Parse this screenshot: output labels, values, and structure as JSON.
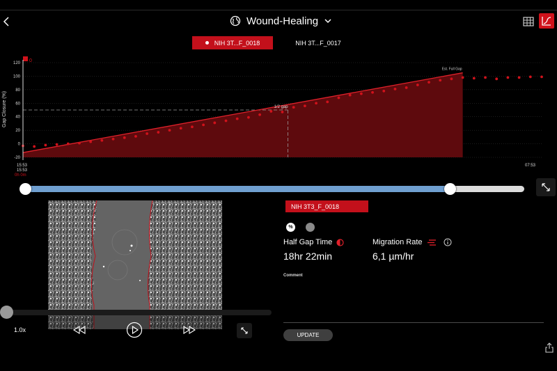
{
  "header": {
    "title": "Wound-Healing",
    "back_icon": "chevron-left-icon",
    "globe_icon": "globe-icon",
    "dropdown_icon": "chevron-down-icon",
    "grid_icon": "table-grid-icon",
    "graph_icon": "line-graph-icon",
    "accent_color": "#c3101b"
  },
  "tabs": [
    {
      "label": "NIH 3T...F_0018",
      "active": true
    },
    {
      "label": "NIH 3T...F_0017",
      "active": false
    }
  ],
  "chart_data": {
    "type": "scatter",
    "ylabel": "Gap Closure (%)",
    "yticks": [
      "120",
      "100",
      "80",
      "60",
      "40",
      "20",
      "0",
      "-20"
    ],
    "ylim": [
      -20,
      120
    ],
    "x_start_label": "15:53",
    "x_end_label": "07:53",
    "cursor_time": "15:53",
    "cursor_elapsed": "0h 0m",
    "legend_marker": "0",
    "annotations": {
      "half_gap": "1/2 gap",
      "full_gap": "Est. Full Gap"
    },
    "half_gap_level": 50,
    "grid": true,
    "series": [
      {
        "color": "#d0121b",
        "x": [
          0,
          1,
          2,
          3,
          4,
          5,
          6,
          7,
          8,
          9,
          10,
          11,
          12,
          13,
          14,
          15,
          16,
          17,
          18,
          19,
          20,
          21,
          22,
          23,
          24,
          25,
          26,
          27,
          28,
          29,
          30,
          31,
          32,
          33,
          34,
          35,
          36,
          37,
          38,
          39
        ],
        "y": [
          -3,
          -4,
          -2,
          -1,
          0,
          1,
          3,
          5,
          7,
          9,
          11,
          15,
          17,
          20,
          23,
          25,
          28,
          31,
          34,
          37,
          39,
          43,
          48,
          47,
          54,
          56,
          60,
          62,
          68,
          72,
          74,
          76,
          78,
          81,
          83,
          87,
          91,
          94,
          96,
          98
        ]
      }
    ],
    "extra_points": {
      "x": [
        40,
        41,
        42,
        43,
        44,
        45,
        46
      ],
      "y": [
        97,
        98,
        96,
        98,
        98,
        99,
        99
      ]
    },
    "fit_line": {
      "x": [
        0,
        39
      ],
      "y": [
        -13,
        105
      ]
    },
    "half_gap_x": 23.5
  },
  "slider": {
    "start_fraction": 0.0,
    "end_fraction": 0.851
  },
  "expand_icon": "expand-arrows-icon",
  "video": {
    "speed": "1.0x",
    "rewind_icon": "rewind-icon",
    "play_icon": "play-icon",
    "forward_icon": "fast-forward-icon",
    "fullscreen_icon": "expand-arrows-icon",
    "progress": 0.0
  },
  "details": {
    "sample_name": "NIH 3T3_F_0018",
    "percent_toggle": "%",
    "half_gap_label": "Half Gap Time",
    "half_gap_value": "18hr 22min",
    "half_gap_icon": "half-circle-icon",
    "migration_label": "Migration Rate",
    "migration_value": "6,1 µm/hr",
    "migration_icon": "migration-lines-icon",
    "info_icon": "info-icon",
    "comment_label": "Comment",
    "update_label": "UPDATE"
  },
  "share_icon": "share-icon"
}
